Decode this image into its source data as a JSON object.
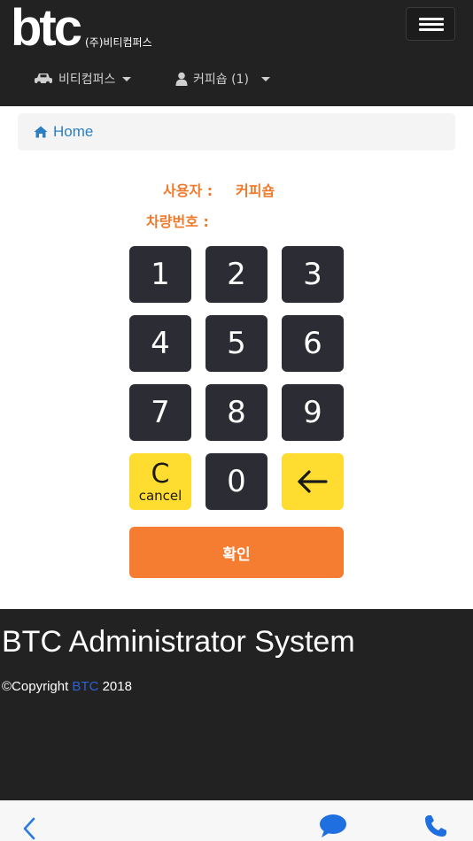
{
  "header": {
    "logo": "btc",
    "company": "(주)비티컴퍼스",
    "menu_icon": "hamburger-icon",
    "nav": [
      {
        "label": "비티컴퍼스",
        "icon": "car-icon"
      },
      {
        "label": "커피숍 (1)",
        "icon": "user-icon"
      }
    ]
  },
  "breadcrumb": {
    "label": "Home",
    "icon": "home-icon"
  },
  "info": {
    "user_label": "사용자 :",
    "user_value": "커피숍",
    "vehicle_label": "차량번호 :",
    "vehicle_value": ""
  },
  "keypad": {
    "keys": [
      "1",
      "2",
      "3",
      "4",
      "5",
      "6",
      "7",
      "8",
      "9"
    ],
    "cancel_main": "C",
    "cancel_sub": "cancel",
    "zero": "0",
    "backspace_icon": "arrow-left-icon"
  },
  "confirm_label": "확인",
  "footer": {
    "title": "BTC Administrator System",
    "copyright_prefix": "©Copyright",
    "copyright_link": "BTC",
    "copyright_year": "2018"
  },
  "bottom_bar": {
    "icons": [
      "back-chevron-icon",
      "chat-icon",
      "phone-icon"
    ]
  },
  "colors": {
    "header_bg": "#222222",
    "accent_orange": "#f57d31",
    "key_dark": "#2c2c34",
    "key_yellow": "#fedc30",
    "link_blue": "#2d7fc1"
  }
}
